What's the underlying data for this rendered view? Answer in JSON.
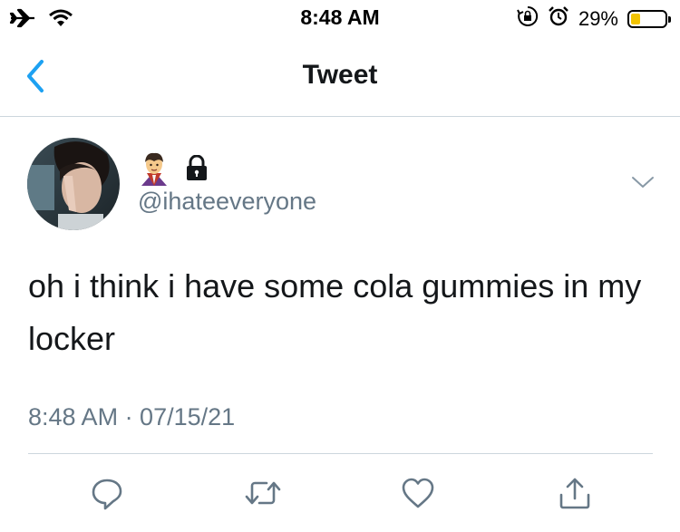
{
  "status_bar": {
    "time": "8:48 AM",
    "battery_percent": "29%",
    "battery_level": 0.29,
    "battery_fill_color": "#f2c300",
    "icons": [
      "airplane-icon",
      "wifi-icon",
      "orientation-lock-icon",
      "alarm-icon",
      "battery-icon"
    ]
  },
  "nav": {
    "title": "Tweet",
    "back_icon": "chevron-left-icon",
    "accent_color": "#1da1f2"
  },
  "tweet": {
    "display_name_icons": [
      "vampire-emoji",
      "lock-icon"
    ],
    "username": "@ihateeveryone",
    "text": "oh i think i have some cola gummies in my locker",
    "timestamp": "8:48 AM · 07/15/21",
    "actions": [
      "reply-icon",
      "retweet-icon",
      "like-icon",
      "share-icon"
    ]
  }
}
